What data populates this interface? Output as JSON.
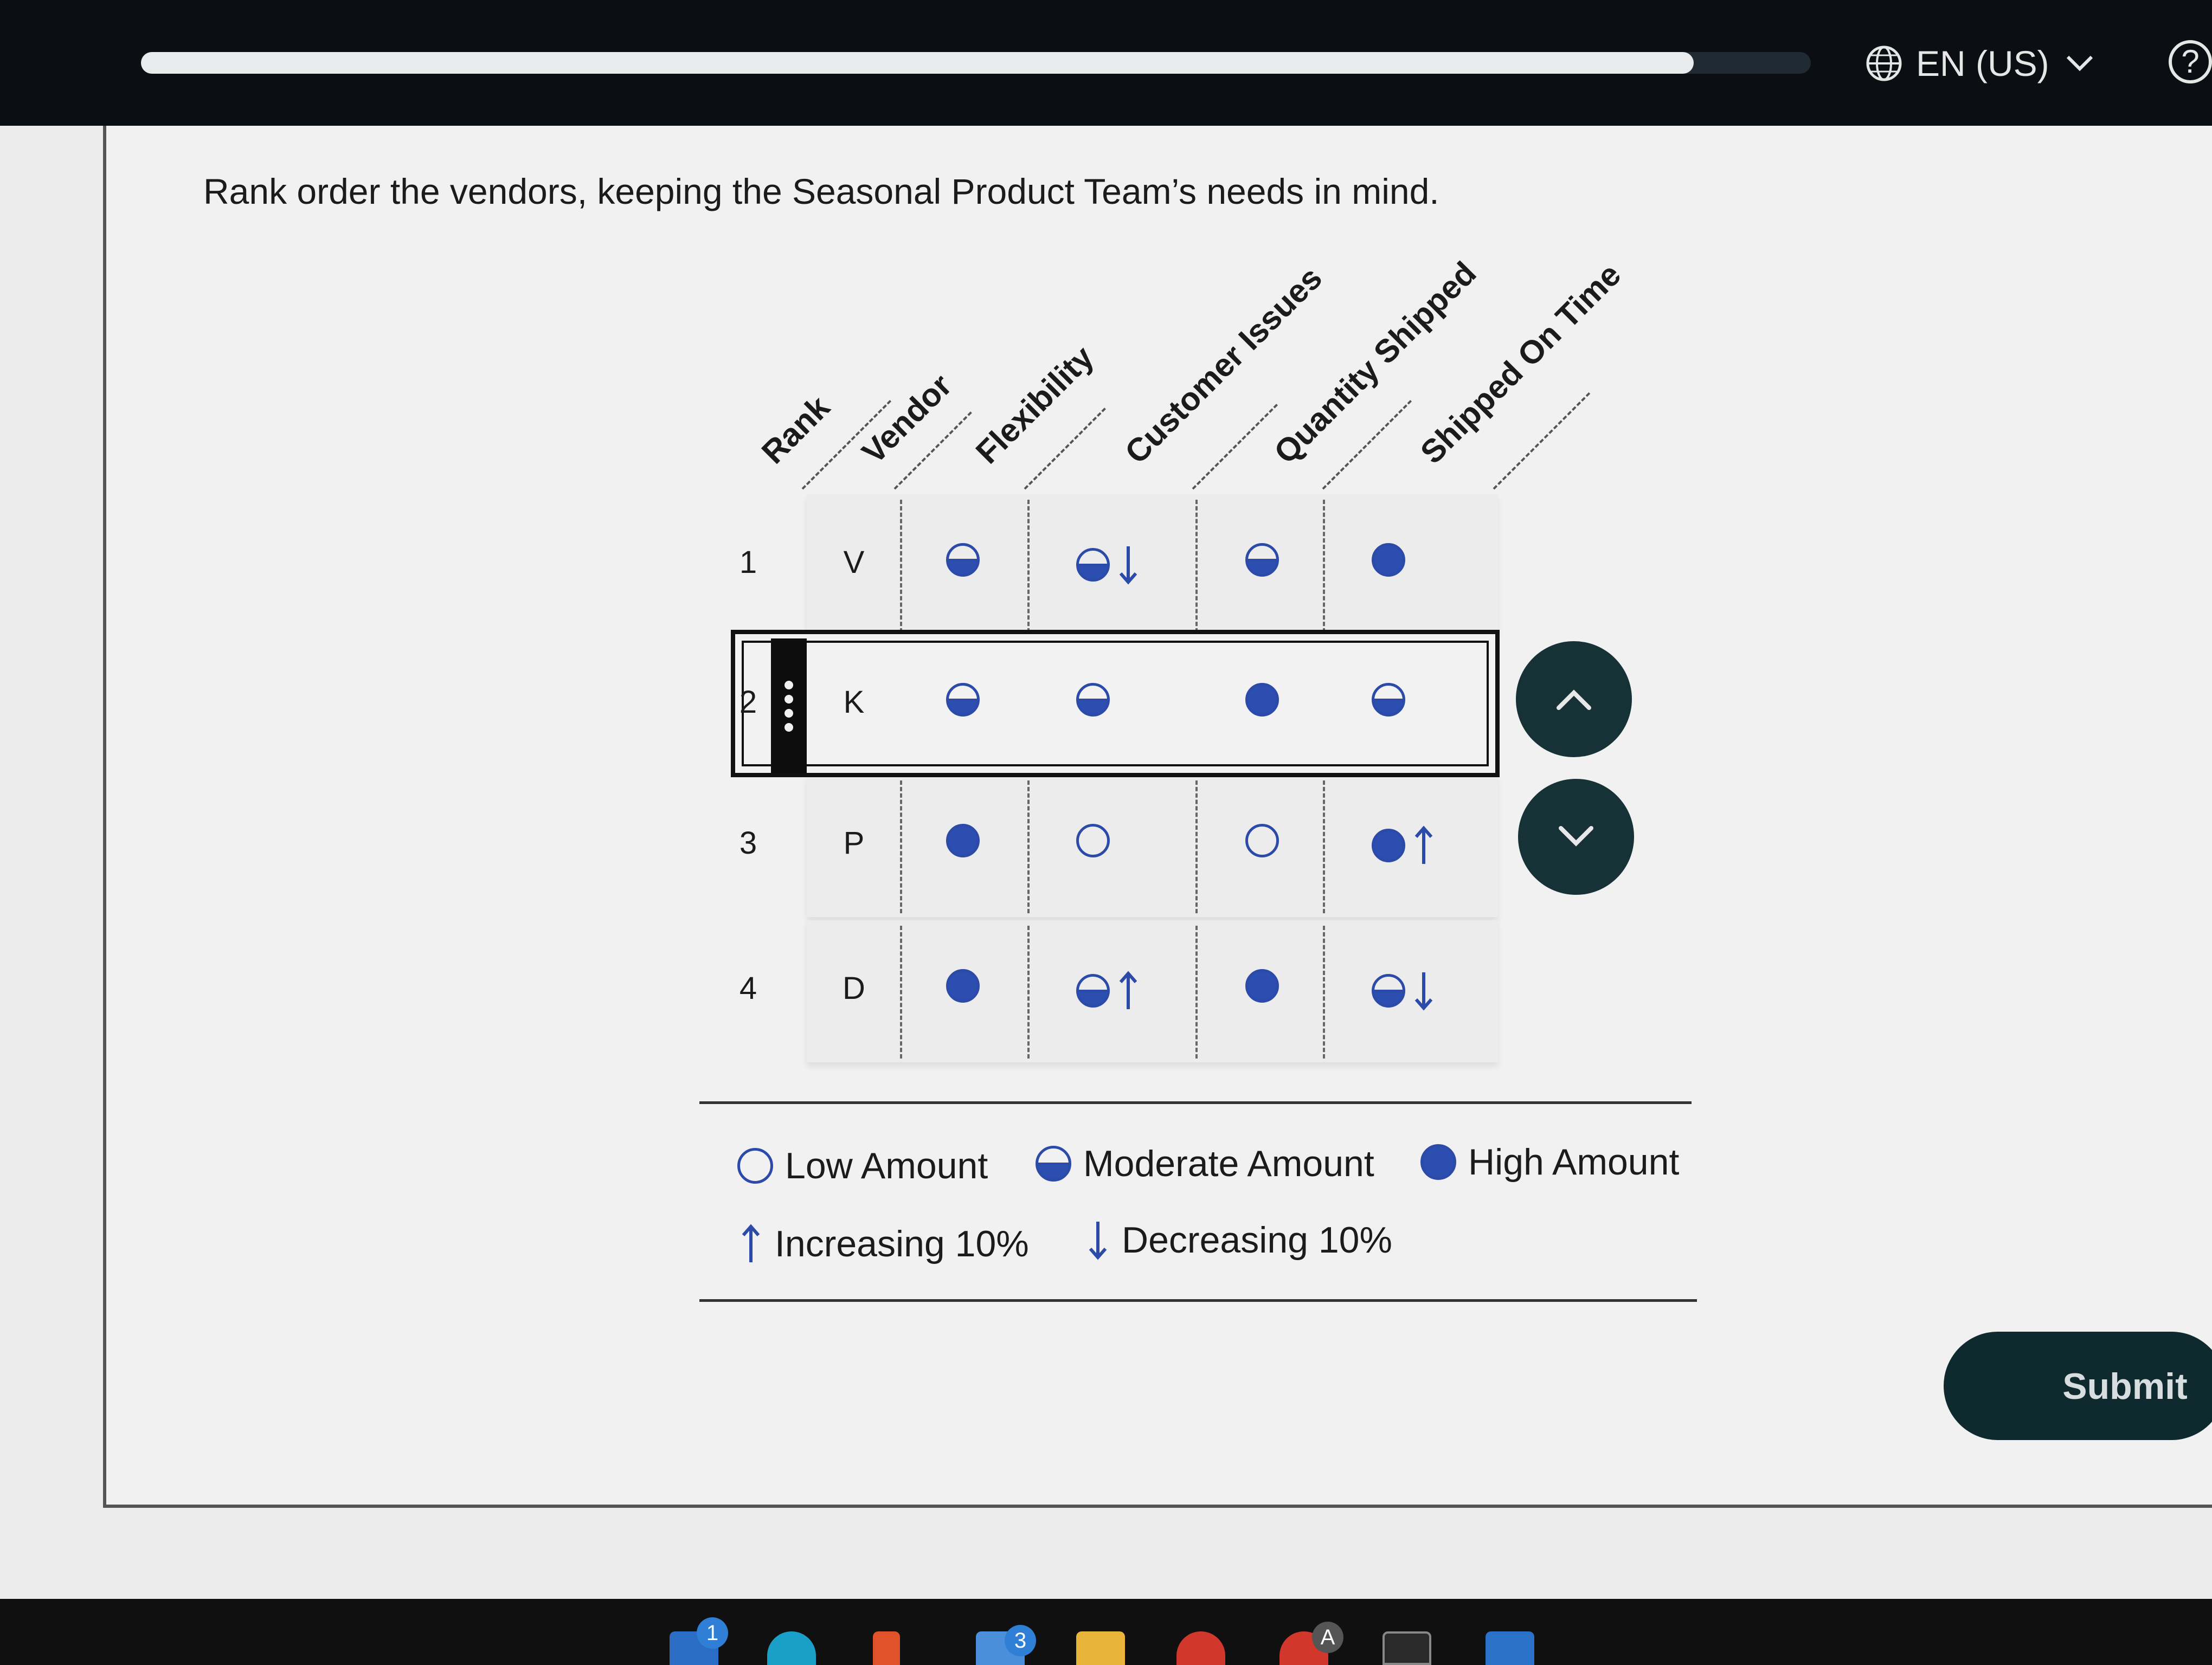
{
  "header": {
    "progress_percent": 93,
    "language_label": "EN (US)",
    "help_label": "?"
  },
  "instruction": "Rank order the vendors, keeping the Seasonal Product Team’s needs in mind.",
  "columns": [
    "Rank",
    "Vendor",
    "Flexibility",
    "Customer Issues",
    "Quantity Shipped",
    "Shipped On Time"
  ],
  "rows": [
    {
      "rank": "1",
      "vendor": "V",
      "cells": [
        {
          "level": "moderate",
          "trend": "none"
        },
        {
          "level": "moderate",
          "trend": "down"
        },
        {
          "level": "moderate",
          "trend": "none"
        },
        {
          "level": "high",
          "trend": "none"
        }
      ]
    },
    {
      "rank": "2",
      "vendor": "K",
      "cells": [
        {
          "level": "moderate",
          "trend": "none"
        },
        {
          "level": "moderate",
          "trend": "none"
        },
        {
          "level": "high",
          "trend": "none"
        },
        {
          "level": "moderate",
          "trend": "none"
        }
      ]
    },
    {
      "rank": "3",
      "vendor": "P",
      "cells": [
        {
          "level": "high",
          "trend": "none"
        },
        {
          "level": "low",
          "trend": "none"
        },
        {
          "level": "low",
          "trend": "none"
        },
        {
          "level": "high",
          "trend": "up"
        }
      ]
    },
    {
      "rank": "4",
      "vendor": "D",
      "cells": [
        {
          "level": "high",
          "trend": "none"
        },
        {
          "level": "moderate",
          "trend": "up"
        },
        {
          "level": "high",
          "trend": "none"
        },
        {
          "level": "moderate",
          "trend": "down"
        }
      ]
    }
  ],
  "selected_row": 2,
  "move_buttons": {
    "up_icon": "chevron-up-icon",
    "down_icon": "chevron-down-icon"
  },
  "legend": {
    "low": "Low Amount",
    "moderate": "Moderate Amount",
    "high": "High Amount",
    "increasing": "Increasing 10%",
    "decreasing": "Decreasing 10%"
  },
  "submit_label": "Submit",
  "taskbar": {
    "badges": [
      "1",
      "3",
      "A"
    ]
  },
  "colors": {
    "accent_blue": "#2b4eb0",
    "button_dark": "#173236",
    "topbar": "#0b0e12"
  }
}
